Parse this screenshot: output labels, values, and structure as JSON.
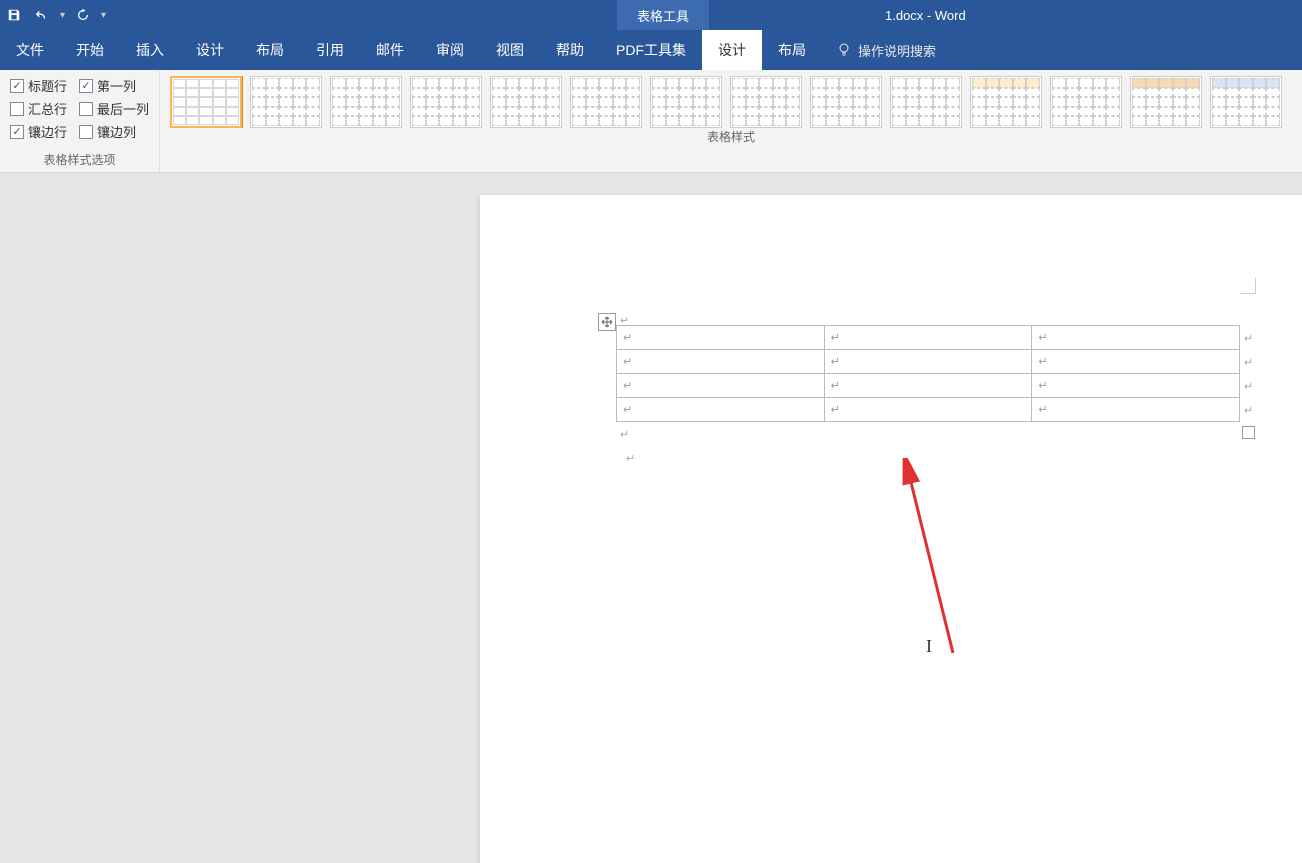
{
  "titlebar": {
    "context_tab": "表格工具",
    "doc_title": "1.docx  -  Word"
  },
  "tabs": {
    "file": "文件",
    "home": "开始",
    "insert": "插入",
    "design": "设计",
    "layout": "布局",
    "references": "引用",
    "mailings": "邮件",
    "review": "审阅",
    "view": "视图",
    "help": "帮助",
    "pdf": "PDF工具集",
    "table_design": "设计",
    "table_layout": "布局",
    "tell_me": "操作说明搜索"
  },
  "style_options": {
    "header_row": "标题行",
    "first_col": "第一列",
    "total_row": "汇总行",
    "last_col": "最后一列",
    "banded_row": "镶边行",
    "banded_col": "镶边列",
    "group_label": "表格样式选项"
  },
  "gallery": {
    "group_label": "表格样式"
  },
  "paragraph_mark": "↵"
}
